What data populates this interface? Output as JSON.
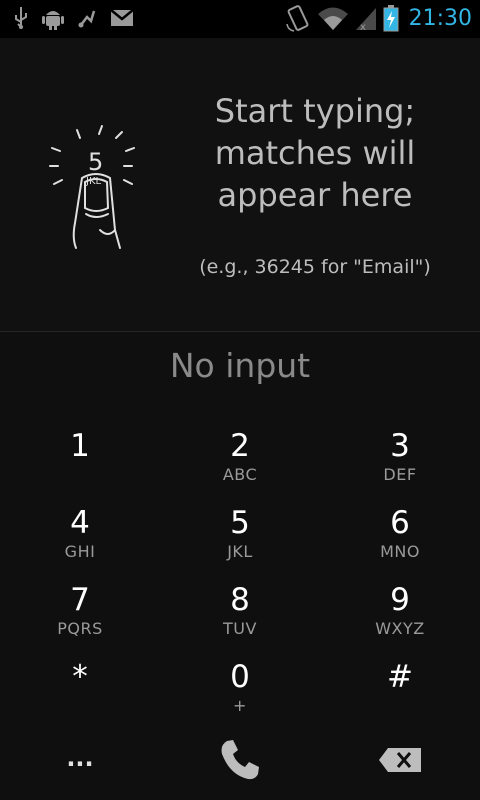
{
  "status_bar": {
    "time": "21:30",
    "icons": [
      "usb-icon",
      "android-debug-icon",
      "transfer-icon",
      "gmail-icon",
      "rotation-lock-icon",
      "wifi-icon",
      "signal-icon",
      "battery-charging-icon"
    ]
  },
  "hint": {
    "title": "Start typing;\nmatches will\nappear here",
    "example": "(e.g., 36245 for \"Email\")",
    "finger_digit": "5"
  },
  "digits_display": {
    "placeholder": "No input"
  },
  "keypad": [
    {
      "number": "1",
      "letters": ""
    },
    {
      "number": "2",
      "letters": "ABC"
    },
    {
      "number": "3",
      "letters": "DEF"
    },
    {
      "number": "4",
      "letters": "GHI"
    },
    {
      "number": "5",
      "letters": "JKL"
    },
    {
      "number": "6",
      "letters": "MNO"
    },
    {
      "number": "7",
      "letters": "PQRS"
    },
    {
      "number": "8",
      "letters": "TUV"
    },
    {
      "number": "9",
      "letters": "WXYZ"
    },
    {
      "number": "*",
      "letters": ""
    },
    {
      "number": "0",
      "letters": "+"
    },
    {
      "number": "#",
      "letters": ""
    }
  ],
  "bottom_bar": {
    "menu_label": "...",
    "call_icon": "phone-icon",
    "delete_icon": "backspace-icon"
  },
  "colors": {
    "accent": "#33b5e5",
    "background": "#0f0f0f"
  }
}
